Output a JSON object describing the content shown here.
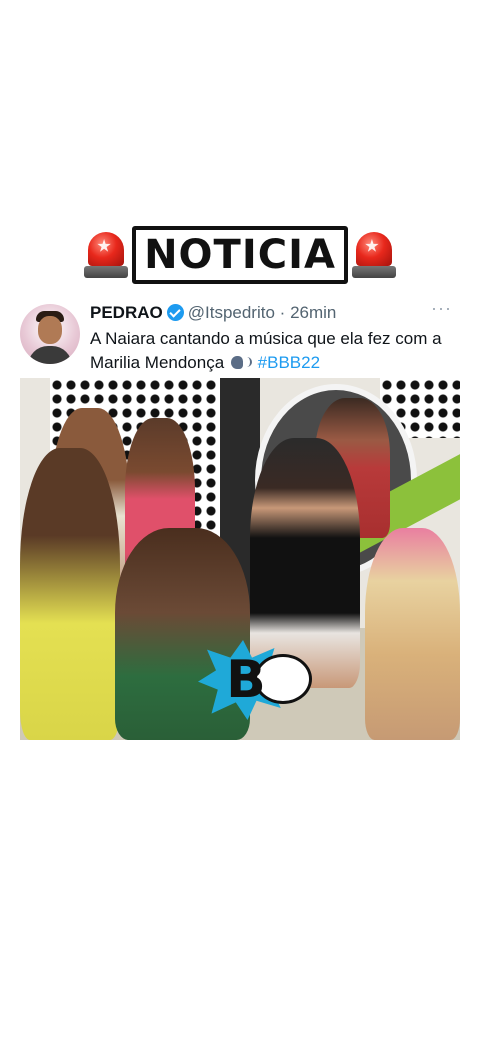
{
  "headline": {
    "title": "NOTICIA",
    "left_icon": "siren-icon",
    "right_icon": "siren-icon"
  },
  "tweet": {
    "display_name": "PEDRAO",
    "verified_icon": "verified-badge-icon",
    "handle": "@Itspedrito",
    "separator": "·",
    "time": "26min",
    "more": "···",
    "text_main": "A Naiara cantando a música que ela fez com a Marilia Mendonça",
    "emoji_icon": "speaking-head-icon",
    "hashtag": "#BBB22",
    "media_logo_letter": "B"
  },
  "colors": {
    "accent": "#1d9bf0",
    "text": "#0f1419",
    "muted": "#536471"
  }
}
